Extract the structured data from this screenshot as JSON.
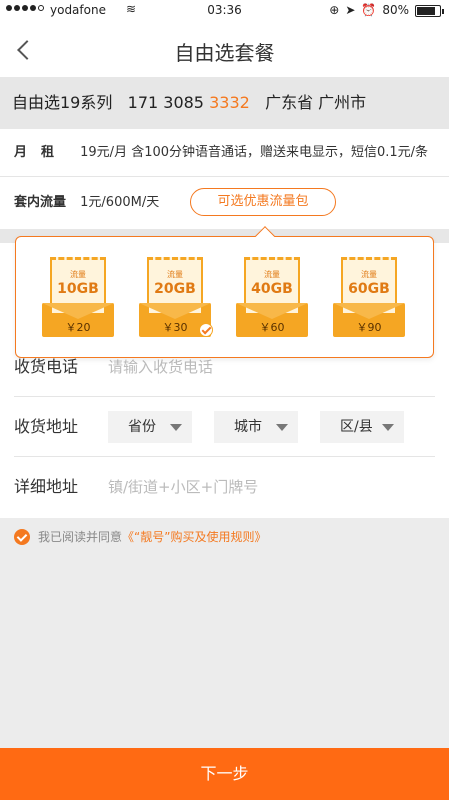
{
  "status_bar": {
    "carrier": "yodafone",
    "time": "03:36",
    "battery": "80%",
    "battery_level": 0.8,
    "signal_bars_filled": 4,
    "signal_bars_total": 5
  },
  "nav": {
    "title": "自由选套餐",
    "back_icon": "chevron-left-icon"
  },
  "plan": {
    "series": "自由选19系列",
    "number_prefix": "171 3085",
    "number_highlight": "3332",
    "location": "广东省 广州市"
  },
  "rent": {
    "label": "月租",
    "text": "19元/月 含100分钟语音通话，赠送来电显示，短信0.1元/条"
  },
  "data_plan": {
    "label": "套内流量",
    "value": "1元/600M/天",
    "pack_button": "可选优惠流量包"
  },
  "packages": [
    {
      "caption": "流量",
      "size": "10GB",
      "price": "￥20",
      "selected": false
    },
    {
      "caption": "流量",
      "size": "20GB",
      "price": "￥30",
      "selected": true
    },
    {
      "caption": "流量",
      "size": "40GB",
      "price": "￥60",
      "selected": false
    },
    {
      "caption": "流量",
      "size": "60GB",
      "price": "￥90",
      "selected": false
    }
  ],
  "form": {
    "phone_label": "收货电话",
    "phone_placeholder": "请输入收货电话",
    "address_label": "收货地址",
    "province": "省份",
    "city": "城市",
    "district": "区/县",
    "detail_label": "详细地址",
    "detail_placeholder": "镇/街道+小区+门牌号"
  },
  "agreement": {
    "prefix": "我已阅读并同意",
    "link": "《“靓号”购买及使用规则》",
    "checked": true
  },
  "next_button": "下一步",
  "colors": {
    "accent": "#f47920",
    "primary_button": "#ff6a13",
    "package_gold": "#f5a623"
  }
}
